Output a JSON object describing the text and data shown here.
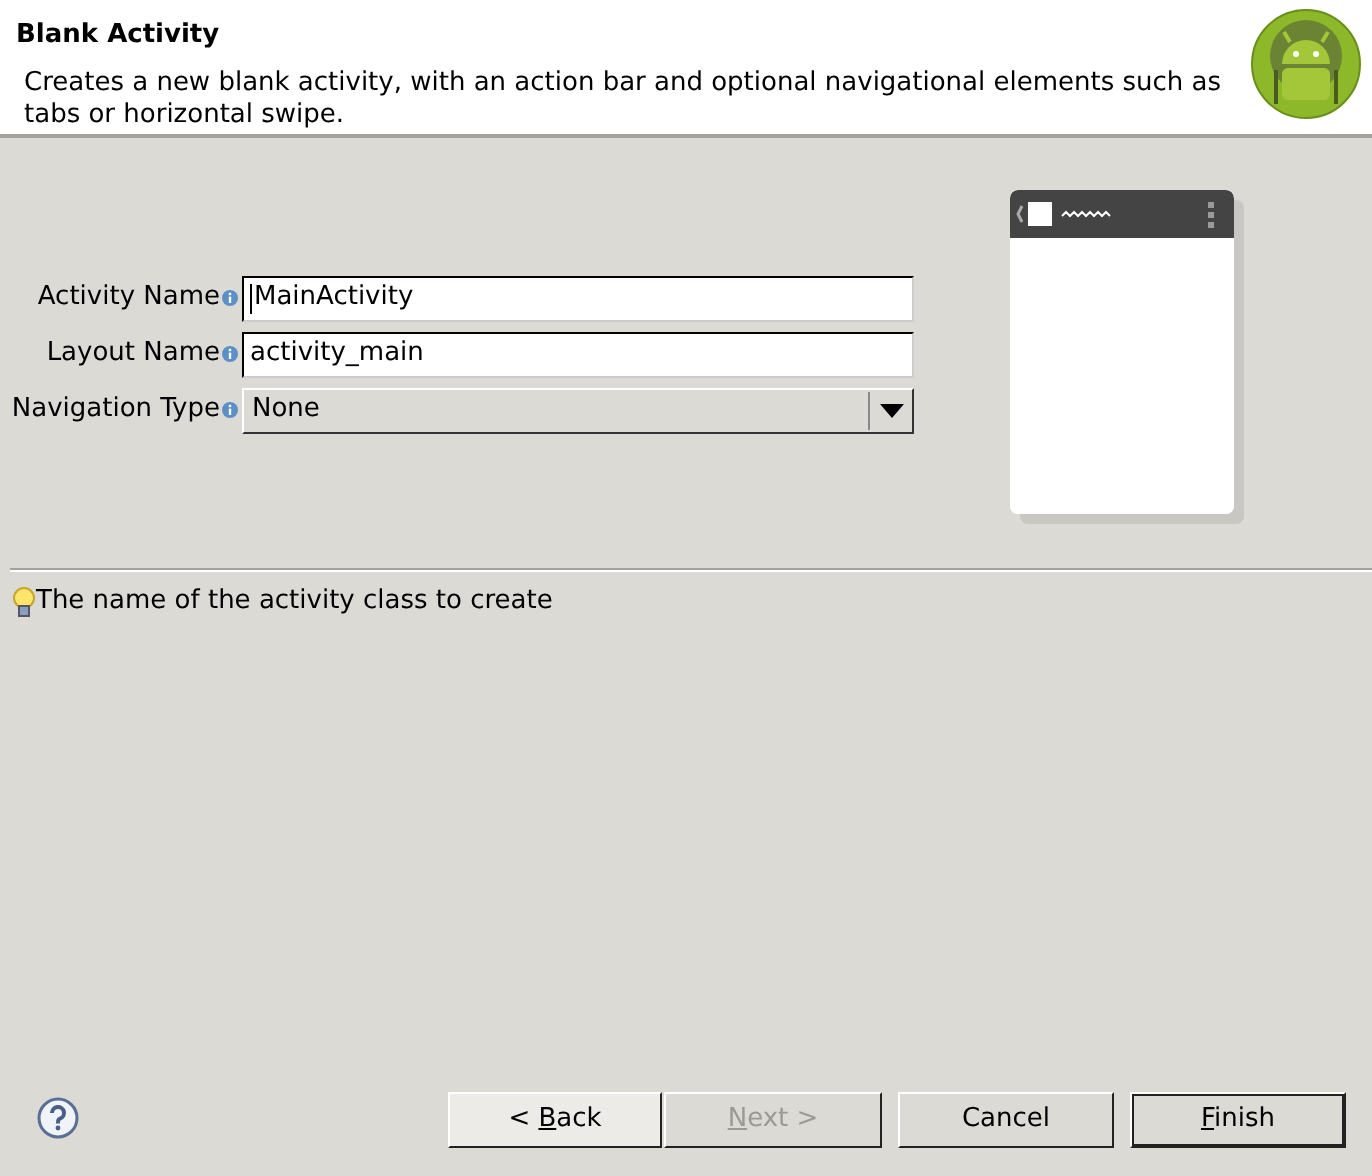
{
  "header": {
    "title": "Blank Activity",
    "description": "Creates a new blank activity, with an action bar and optional navigational elements such as tabs or horizontal swipe."
  },
  "fields": [
    {
      "kind": "text",
      "label": "Activity Name",
      "value": "MainActivity",
      "focused": true
    },
    {
      "kind": "text",
      "label": "Layout Name",
      "value": "activity_main",
      "focused": false
    },
    {
      "kind": "dropdown",
      "label": "Navigation Type",
      "value": "None"
    }
  ],
  "hint": "The name of the activity class to create",
  "buttons": [
    {
      "label_parts": [
        {
          "text": "< ",
          "underlined": false
        },
        {
          "text": "B",
          "underlined": true
        },
        {
          "text": "ack",
          "underlined": false
        }
      ],
      "disabled": false,
      "default": false
    },
    {
      "label_parts": [
        {
          "text": "N",
          "underlined": true
        },
        {
          "text": "ext >",
          "underlined": false
        }
      ],
      "disabled": true,
      "default": false
    },
    {
      "label_parts": [
        {
          "text": "Cancel",
          "underlined": false
        }
      ],
      "disabled": false,
      "default": false
    },
    {
      "label_parts": [
        {
          "text": "F",
          "underlined": true
        },
        {
          "text": "inish",
          "underlined": false
        }
      ],
      "disabled": false,
      "default": true
    }
  ]
}
